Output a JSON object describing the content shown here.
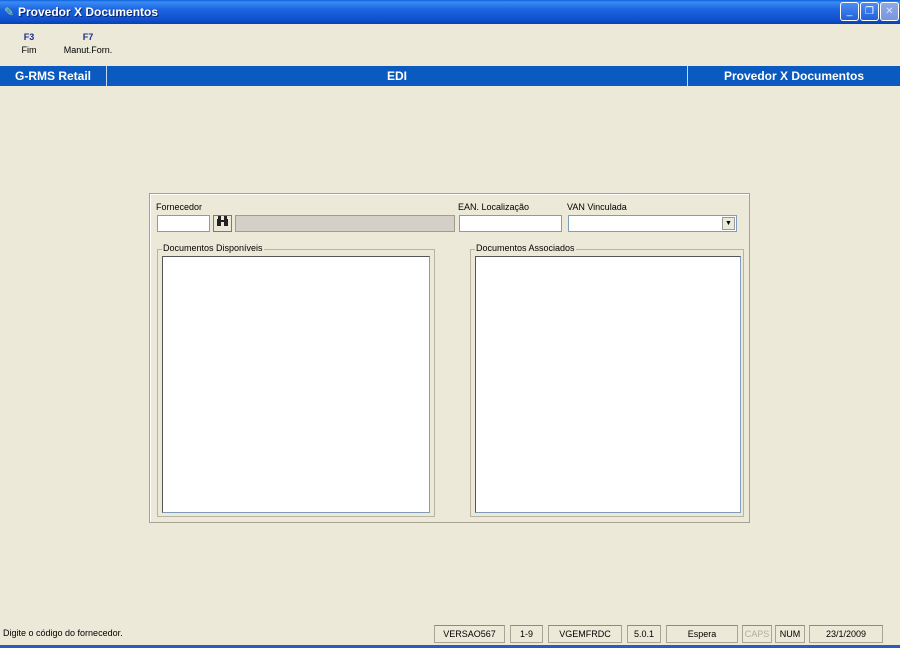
{
  "window": {
    "title": "Provedor X Documentos",
    "buttons": {
      "minimize": "_",
      "restore": "❐",
      "close": "✕"
    }
  },
  "fkeys": [
    {
      "key": "F3",
      "label": "Fim"
    },
    {
      "key": "F7",
      "label": "Manut.Forn."
    }
  ],
  "banner": {
    "left": "G-RMS Retail",
    "center": "EDI",
    "right": "Provedor X Documentos"
  },
  "form": {
    "fornecedor_label": "Fornecedor",
    "fornecedor_code": "",
    "fornecedor_name": "",
    "ean_label": "EAN. Localização",
    "ean_value": "",
    "van_label": "VAN Vinculada",
    "van_value": "",
    "disponiveis_label": "Documentos Disponíveis",
    "associados_label": "Documentos Associados"
  },
  "statusbar": {
    "message": "Digite o código do fornecedor.",
    "version": "VERSAO567",
    "page": "1-9",
    "program": "VGEMFRDC",
    "release": "5.0.1",
    "state": "Espera",
    "caps": "CAPS",
    "num": "NUM",
    "date": "23/1/2009"
  },
  "colors": {
    "titlebar": "#1D63E0",
    "banner": "#0B5AC0",
    "background": "#ECE9D8"
  }
}
